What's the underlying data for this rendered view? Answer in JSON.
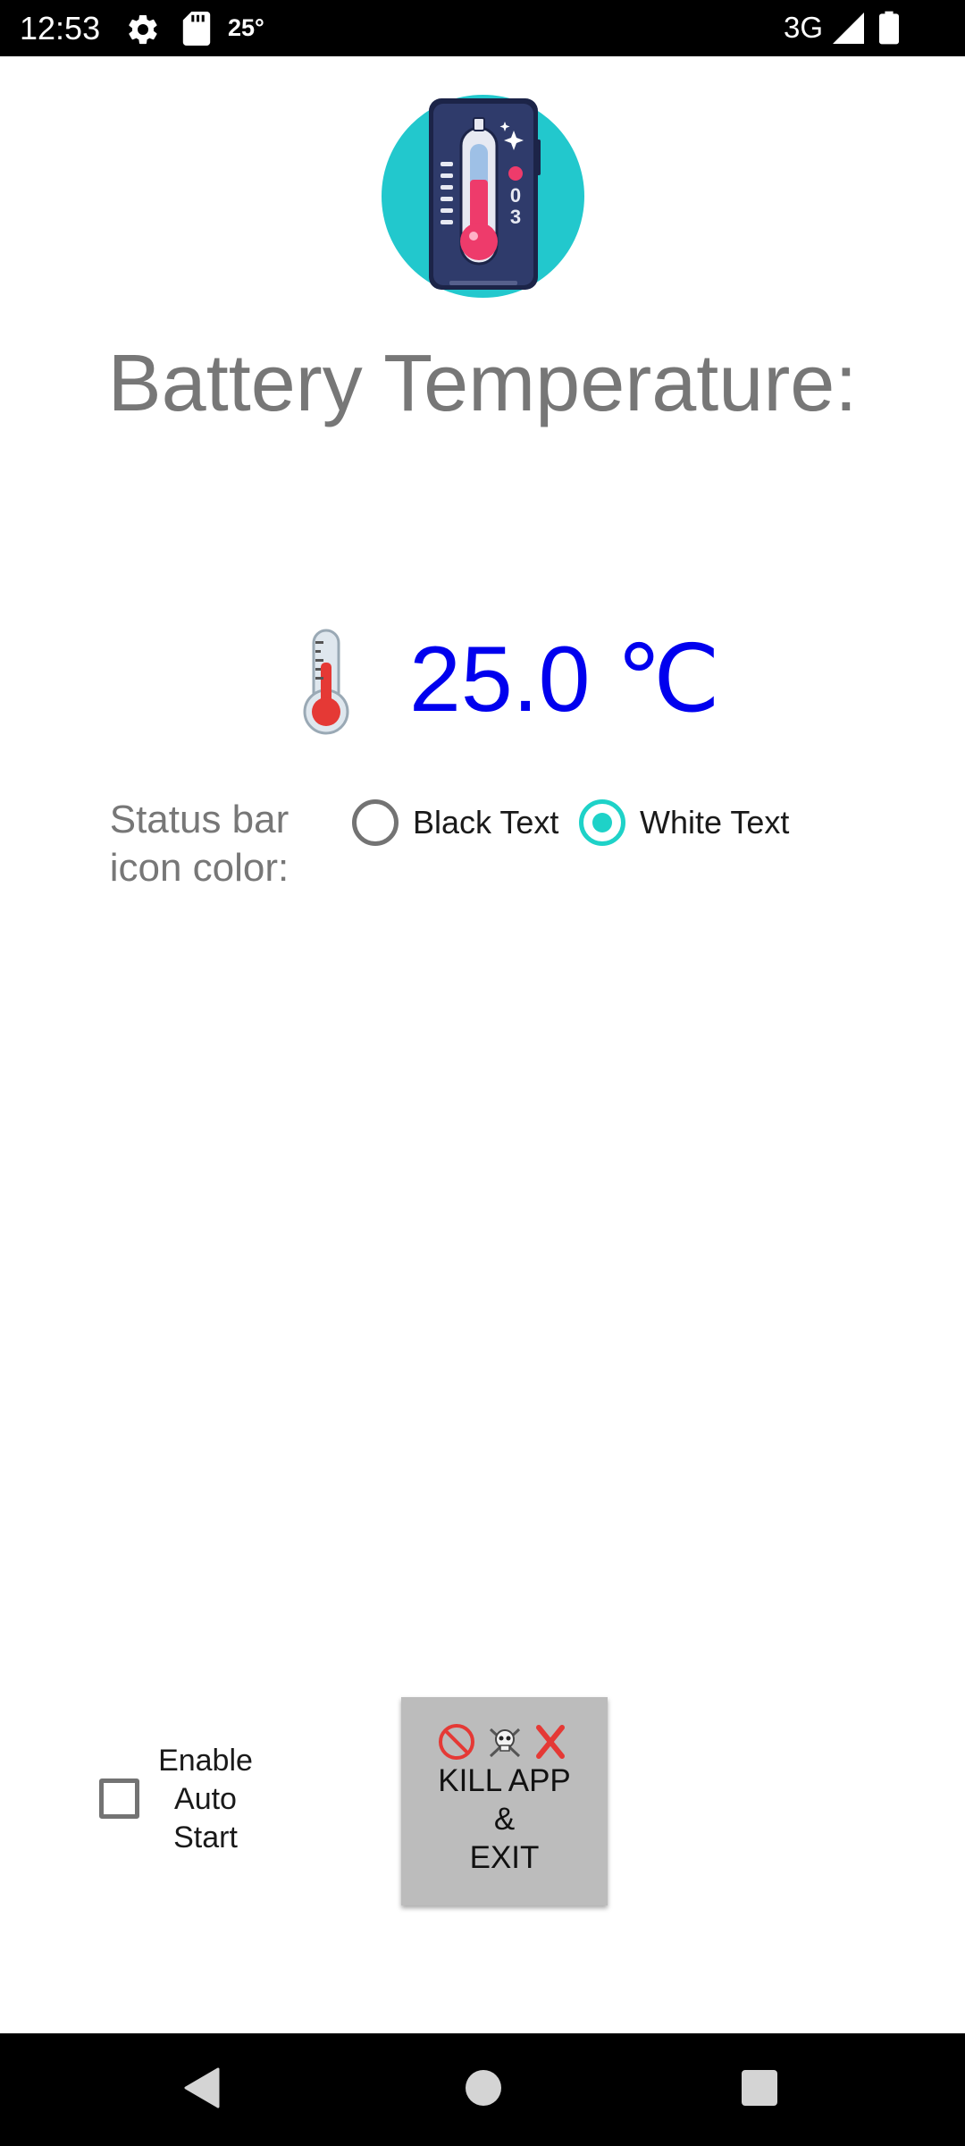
{
  "status_bar": {
    "time": "12:53",
    "temp": "25°",
    "network": "3G",
    "icons": [
      "gear-icon",
      "sd-card-icon",
      "signal-icon",
      "battery-icon"
    ]
  },
  "header": {
    "logo_icon": "battery-thermometer-logo",
    "logo_text": "03",
    "title": "Battery Temperature:"
  },
  "temperature": {
    "icon": "thermometer-icon",
    "value": "25.0 ℃"
  },
  "status_bar_color": {
    "label": "Status bar\nicon color:",
    "options": [
      {
        "label": "Black Text",
        "selected": false
      },
      {
        "label": "White Text",
        "selected": true
      }
    ]
  },
  "auto_start": {
    "label": "Enable\nAuto\nStart",
    "checked": false
  },
  "kill_button": {
    "icons": [
      "no-entry-icon",
      "skull-crossbones-icon",
      "cross-mark-icon"
    ],
    "label": "KILL APP\n&\nEXIT"
  },
  "nav_bar": {
    "buttons": [
      "back-icon",
      "home-icon",
      "recents-icon"
    ]
  },
  "colors": {
    "accent": "#1ed2c8",
    "temperature_text": "#0000ee",
    "title_text": "#777777",
    "button_bg": "#bcbcbc"
  }
}
